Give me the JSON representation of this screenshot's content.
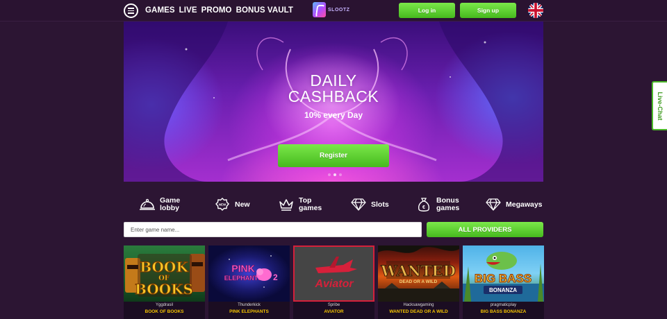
{
  "header": {
    "nav": [
      "GAMES",
      "LIVE",
      "PROMO",
      "BONUS VAULT"
    ],
    "logo_text": "SLOOTZ",
    "login_label": "Log in",
    "signup_label": "Sign up"
  },
  "hero": {
    "title_line1": "DAILY",
    "title_line2": "CASHBACK",
    "subtitle": "10% every Day",
    "cta_label": "Register",
    "slides": 3,
    "active_slide": 1
  },
  "categories": [
    {
      "line1": "Game",
      "line2": "lobby",
      "icon": "bell-icon"
    },
    {
      "line1": "New",
      "line2": "",
      "icon": "new-badge-icon"
    },
    {
      "line1": "Top",
      "line2": "games",
      "icon": "crown-icon"
    },
    {
      "line1": "Slots",
      "line2": "",
      "icon": "diamond-icon"
    },
    {
      "line1": "Bonus",
      "line2": "games",
      "icon": "money-bag-icon"
    },
    {
      "line1": "Megaways",
      "line2": "",
      "icon": "diamond-icon"
    }
  ],
  "search": {
    "placeholder": "Enter game name...",
    "providers_label": "ALL PROVIDERS"
  },
  "games": [
    {
      "provider": "Yggdrasil",
      "name": "BOOK OF BOOKS"
    },
    {
      "provider": "Thunderkick",
      "name": "PINK ELEPHANTS"
    },
    {
      "provider": "Spribe",
      "name": "AVIATOR"
    },
    {
      "provider": "Hacksawgaming",
      "name": "WANTED DEAD OR A WILD"
    },
    {
      "provider": "pragmaticplay",
      "name": "BIG BASS BONANZA"
    }
  ],
  "livechat_label": "Live-Chat",
  "colors": {
    "background": "#2c1533",
    "accent_green": "#5cd02c",
    "game_name_yellow": "#f5c400"
  }
}
